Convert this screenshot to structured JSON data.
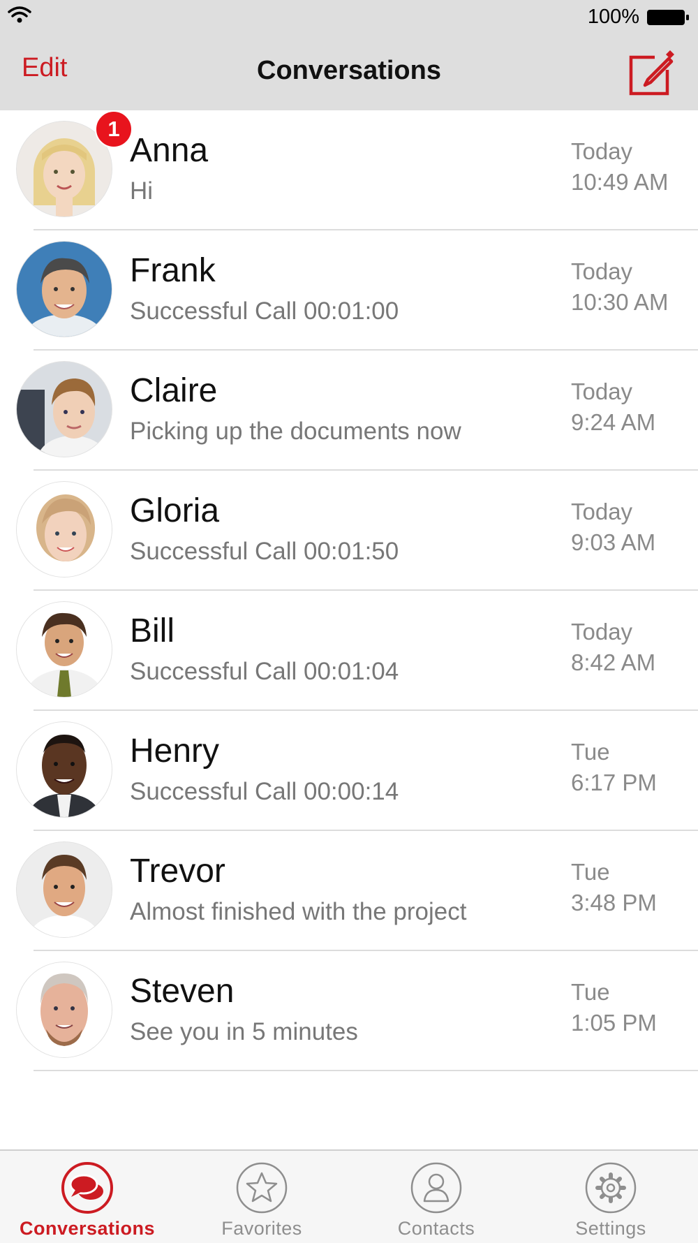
{
  "status_bar": {
    "battery_percent": "100%",
    "wifi_icon": "wifi-icon",
    "battery_icon": "battery-full-icon"
  },
  "nav_bar": {
    "edit_label": "Edit",
    "title": "Conversations",
    "compose_icon": "compose-icon"
  },
  "colors": {
    "accent": "#cc1b22",
    "badge": "#e8141d",
    "bar_background": "#dedede"
  },
  "conversations": [
    {
      "name": "Anna",
      "preview": "Hi",
      "day": "Today",
      "time": "10:49 AM",
      "unread": "1"
    },
    {
      "name": "Frank",
      "preview": "Successful Call  00:01:00",
      "day": "Today",
      "time": "10:30 AM"
    },
    {
      "name": "Claire",
      "preview": "Picking up the documents now",
      "day": "Today",
      "time": "9:24 AM"
    },
    {
      "name": "Gloria",
      "preview": "Successful Call  00:01:50",
      "day": "Today",
      "time": "9:03 AM"
    },
    {
      "name": "Bill",
      "preview": "Successful Call  00:01:04",
      "day": "Today",
      "time": "8:42 AM"
    },
    {
      "name": "Henry",
      "preview": "Successful Call  00:00:14",
      "day": "Tue",
      "time": "6:17 PM"
    },
    {
      "name": "Trevor",
      "preview": "Almost finished with the project",
      "day": "Tue",
      "time": "3:48 PM"
    },
    {
      "name": "Steven",
      "preview": "See you in 5 minutes",
      "day": "Tue",
      "time": "1:05 PM"
    }
  ],
  "tabs": [
    {
      "label": "Conversations",
      "icon": "chat-bubbles-icon",
      "active": true
    },
    {
      "label": "Favorites",
      "icon": "star-icon",
      "active": false
    },
    {
      "label": "Contacts",
      "icon": "person-icon",
      "active": false
    },
    {
      "label": "Settings",
      "icon": "gear-icon",
      "active": false
    }
  ]
}
